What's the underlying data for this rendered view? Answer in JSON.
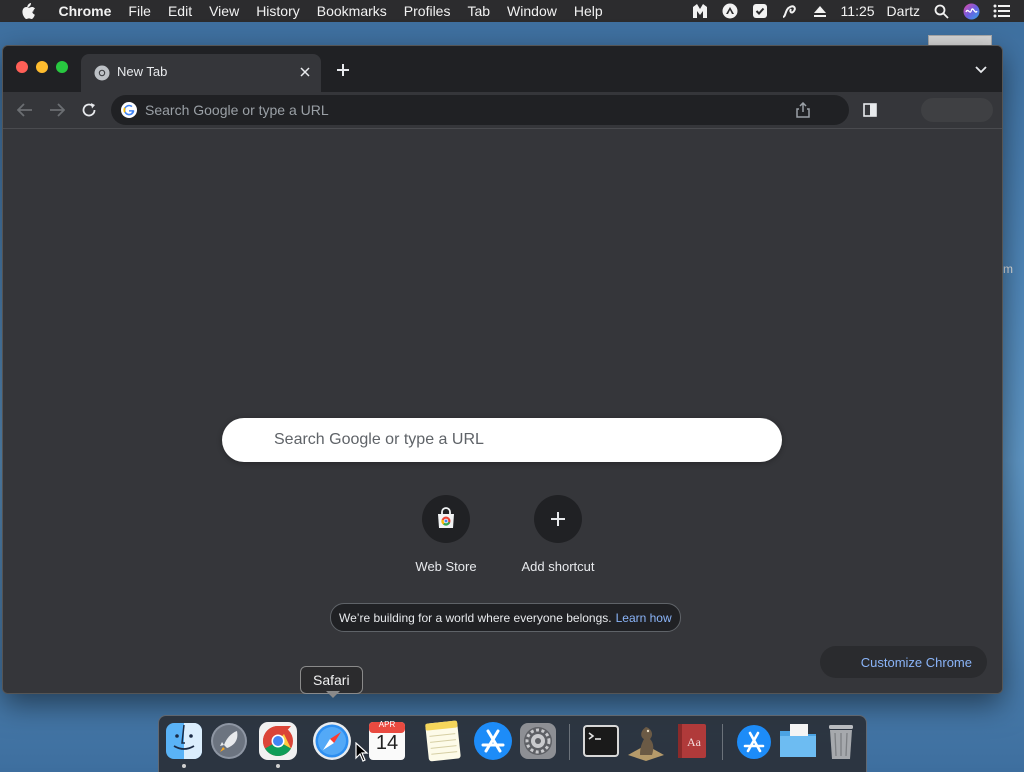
{
  "menubar": {
    "app_name": "Chrome",
    "items": [
      "File",
      "Edit",
      "View",
      "History",
      "Bookmarks",
      "Profiles",
      "Tab",
      "Window",
      "Help"
    ],
    "clock": "11:25",
    "user": "Dartz",
    "status_icons": [
      "malwarebytes-icon",
      "vpn-icon",
      "shield-icon",
      "pen-icon",
      "eject-icon",
      "search-icon",
      "siri-icon",
      "notification-center-icon"
    ]
  },
  "background": {
    "text": "m"
  },
  "chrome": {
    "tab_title": "New Tab",
    "omnibox_placeholder": "Search Google or type a URL",
    "ntp": {
      "search_placeholder": "Search Google or type a URL",
      "shortcuts": [
        {
          "label": "Web Store",
          "icon": "web-store-icon"
        },
        {
          "label": "Add shortcut",
          "icon": "plus-icon"
        }
      ],
      "notice_text": "We’re building for a world where everyone belongs.",
      "notice_link": "Learn how",
      "customize_label": "Customize Chrome"
    }
  },
  "tooltip": {
    "text": "Safari"
  },
  "dock": {
    "apps": [
      "Finder",
      "Launchpad",
      "Google Chrome",
      "Safari",
      "Calendar",
      "Notes",
      "App Store",
      "System Preferences",
      "Terminal",
      "Chess",
      "Dictionary",
      "Downloads",
      "Folder",
      "Trash"
    ],
    "calendar_month": "APR",
    "calendar_day": "14"
  },
  "colors": {
    "menubar_bg": "#2c2c2e",
    "chrome_bg": "#35363a",
    "tabstrip_bg": "#202124",
    "link": "#8ab4f8"
  }
}
